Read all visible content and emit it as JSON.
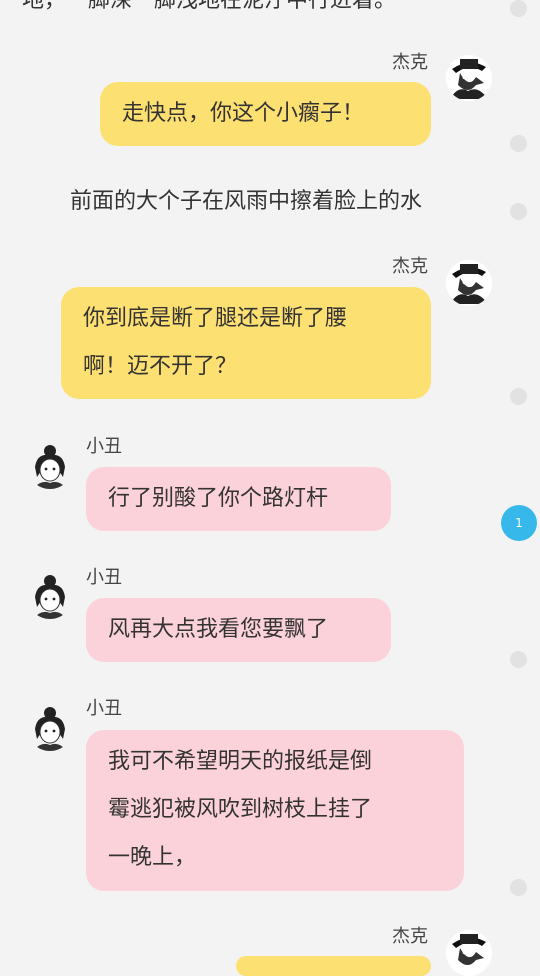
{
  "narration_top": "地，一脚深一脚浅地在泥泞中行进着。",
  "narration_mid": "前面的大个子在风雨中擦着脸上的水",
  "messages": [
    {
      "speaker": "杰克",
      "text": "走快点，你这个小瘸子！"
    },
    {
      "speaker": "杰克",
      "line1": "你到底是断了腿还是断了腰",
      "line2": "啊！迈不开了？"
    },
    {
      "speaker": "小丑",
      "text": "行了别酸了你个路灯杆"
    },
    {
      "speaker": "小丑",
      "text": "风再大点我看您要飘了"
    },
    {
      "speaker": "小丑",
      "line1": "我可不希望明天的报纸是倒",
      "line2": "霉逃犯被风吹到树枝上挂了",
      "line3": "一晚上，"
    },
    {
      "speaker": "杰克"
    }
  ],
  "unread_badge": "1",
  "colors": {
    "background": "#f3f3f3",
    "jack_bubble": "#fde072",
    "clown_bubble": "#fcd2da",
    "badge": "#36b8ea"
  },
  "icons": {
    "jack_avatar": "plague-doctor-avatar-icon",
    "clown_avatar": "clown-avatar-icon"
  }
}
